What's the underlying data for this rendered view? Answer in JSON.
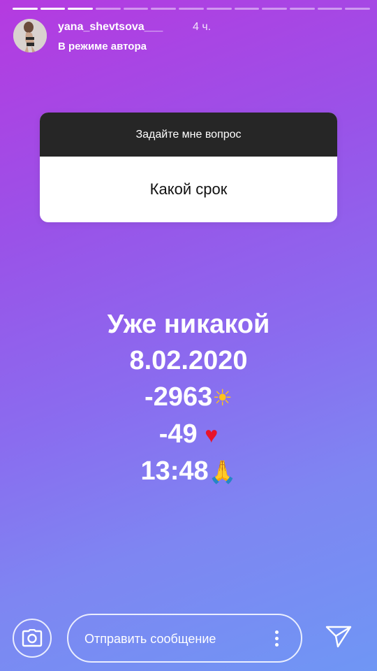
{
  "story": {
    "progress_segments": 13,
    "segments_viewed": 3
  },
  "header": {
    "username": "yana_shevtsova___",
    "time": "4 ч.",
    "subtitle": "В режиме автора"
  },
  "question_sticker": {
    "prompt": "Задайте мне вопрос",
    "answer": "Какой срок"
  },
  "story_text": {
    "lines": [
      {
        "text": "Уже никакой",
        "emoji": ""
      },
      {
        "text": "8.02.2020",
        "emoji": ""
      },
      {
        "text": "-2963",
        "emoji": "☀"
      },
      {
        "text": "-49 ",
        "emoji": "♥"
      },
      {
        "text": "13:48",
        "emoji": "🙏"
      }
    ]
  },
  "bottom_bar": {
    "camera_icon": "camera-icon",
    "message_placeholder": "Отправить сообщение",
    "more_icon": "more-vertical-icon",
    "send_icon": "send-icon"
  },
  "colors": {
    "gradient_top": "#b53ae0",
    "gradient_bottom": "#6f96f4",
    "sticker_header": "#262626"
  }
}
